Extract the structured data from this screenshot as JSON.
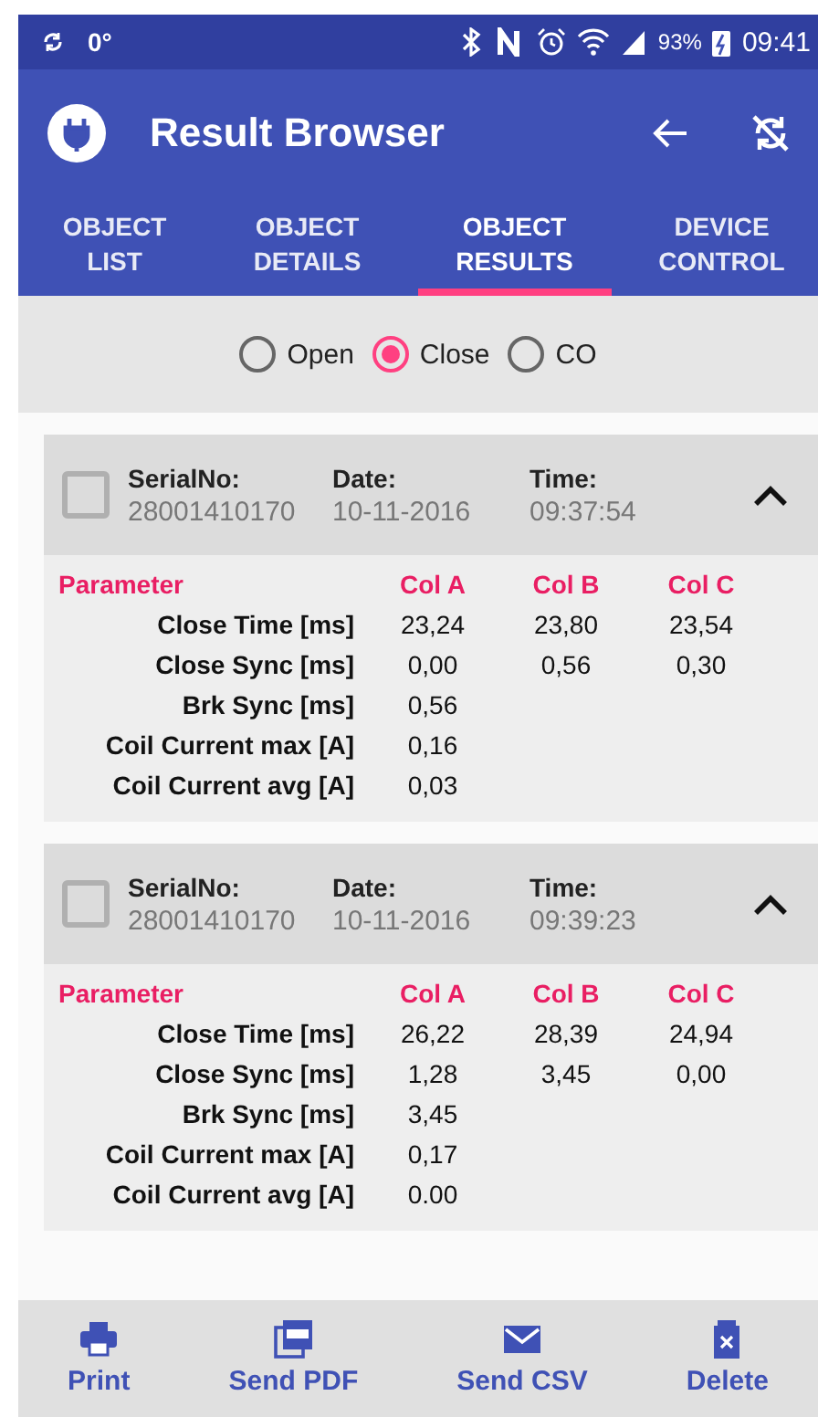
{
  "status_bar": {
    "left_text": "0°",
    "battery": "93%",
    "time": "09:41"
  },
  "app_bar": {
    "title": "Result Browser"
  },
  "tabs": [
    {
      "label": "OBJECT\nLIST",
      "selected": false
    },
    {
      "label": "OBJECT\nDETAILS",
      "selected": false
    },
    {
      "label": "OBJECT\nRESULTS",
      "selected": true
    },
    {
      "label": "DEVICE\nCONTROL",
      "selected": false
    }
  ],
  "radios": [
    {
      "label": "Open",
      "selected": false
    },
    {
      "label": "Close",
      "selected": true
    },
    {
      "label": "CO",
      "selected": false
    }
  ],
  "results": [
    {
      "checked": false,
      "expanded": true,
      "serial_label": "SerialNo:",
      "serial": "28001410170",
      "date_label": "Date:",
      "date": "10-11-2016",
      "time_label": "Time:",
      "time": "09:37:54",
      "columns": [
        "Parameter",
        "Col A",
        "Col B",
        "Col C"
      ],
      "rows": [
        [
          "Close Time [ms]",
          "23,24",
          "23,80",
          "23,54"
        ],
        [
          "Close Sync [ms]",
          "0,00",
          "0,56",
          "0,30"
        ],
        [
          "Brk Sync [ms]",
          "0,56"
        ],
        [
          "Coil Current max [A]",
          "0,16"
        ],
        [
          "Coil Current avg [A]",
          "0,03"
        ]
      ]
    },
    {
      "checked": false,
      "expanded": true,
      "serial_label": "SerialNo:",
      "serial": "28001410170",
      "date_label": "Date:",
      "date": "10-11-2016",
      "time_label": "Time:",
      "time": "09:39:23",
      "columns": [
        "Parameter",
        "Col A",
        "Col B",
        "Col C"
      ],
      "rows": [
        [
          "Close Time [ms]",
          "26,22",
          "28,39",
          "24,94"
        ],
        [
          "Close Sync [ms]",
          "1,28",
          "3,45",
          "0,00"
        ],
        [
          "Brk Sync [ms]",
          "3,45"
        ],
        [
          "Coil Current max [A]",
          "0,17"
        ],
        [
          "Coil Current avg [A]",
          "0.00"
        ]
      ]
    }
  ],
  "actions": [
    {
      "kind": "print",
      "label": "Print"
    },
    {
      "kind": "pdf",
      "label": "Send PDF"
    },
    {
      "kind": "mail",
      "label": "Send CSV"
    },
    {
      "kind": "delete",
      "label": "Delete"
    }
  ]
}
